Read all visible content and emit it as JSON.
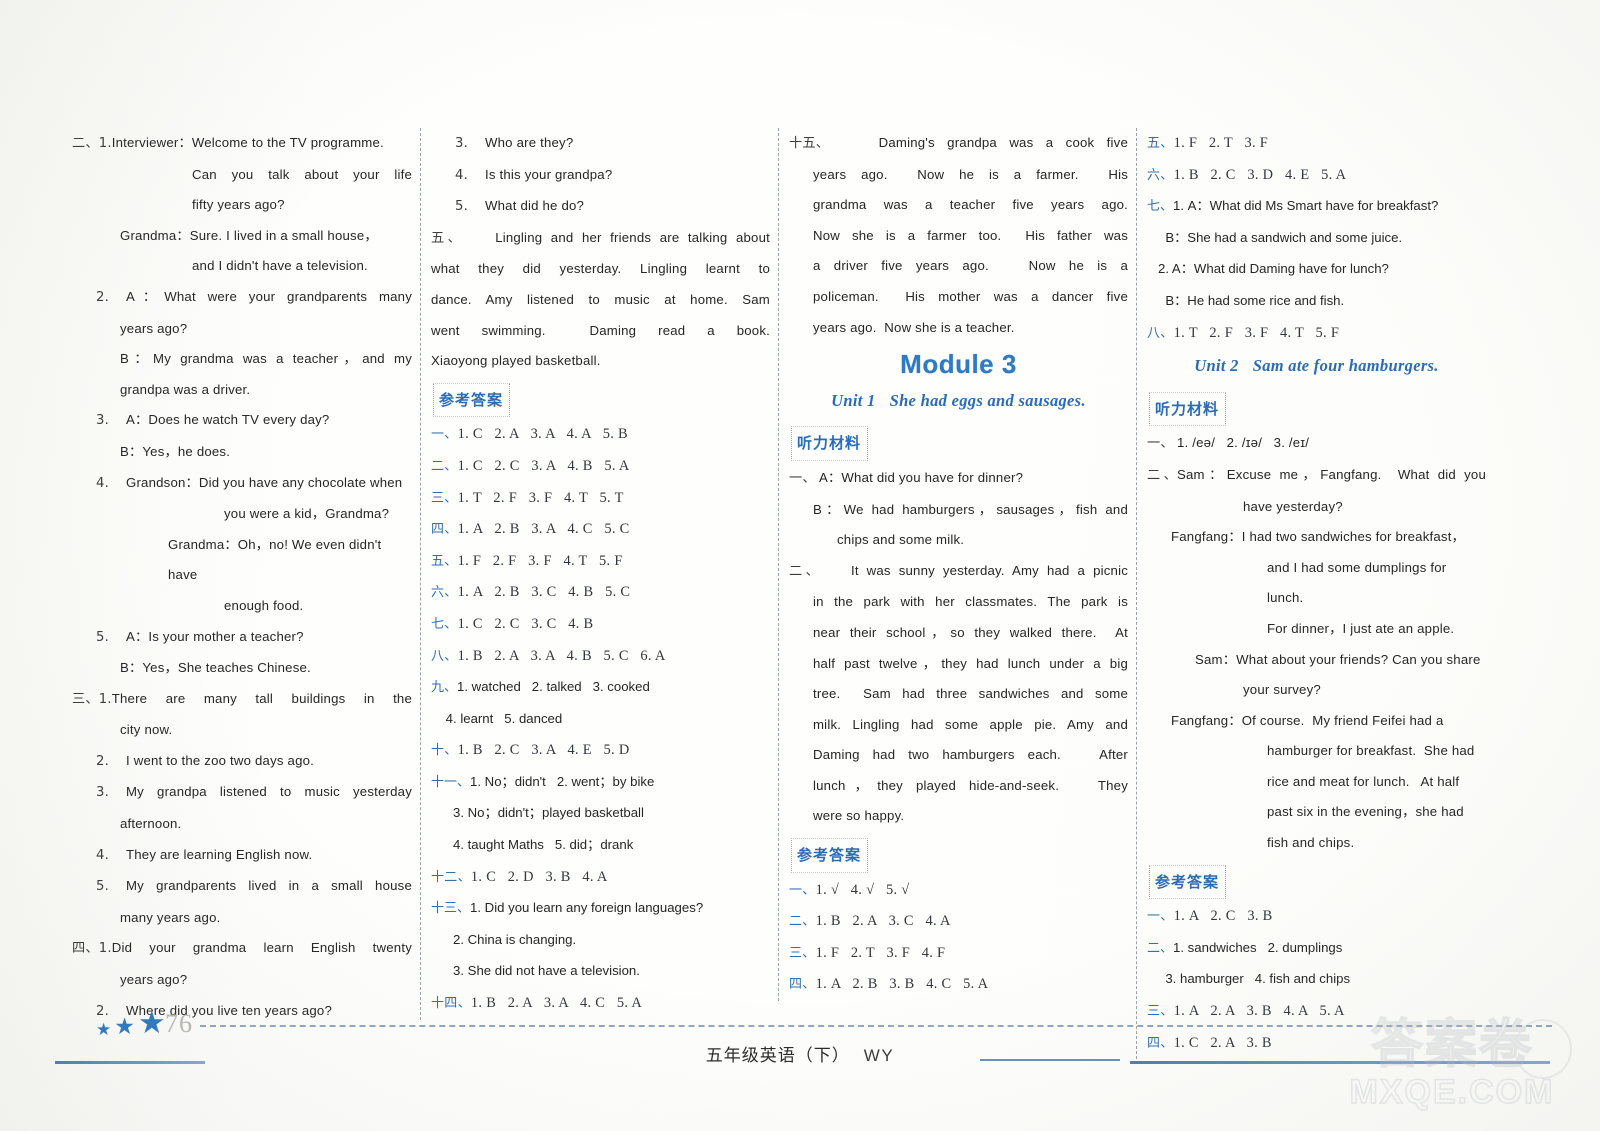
{
  "page": {
    "number": "76",
    "footer_label": "五年级英语（下）",
    "footer_edition": "WY",
    "watermark_cn": "答案卷",
    "watermark_en": "MXQE.COM"
  },
  "labels": {
    "listening_material": "听力材料",
    "reference_answers": "参考答案"
  },
  "column1": {
    "lines": [
      {
        "idx": "二、1.",
        "text": "Interviewer：Welcome to the TV programme.",
        "indent": 0,
        "justify": false
      },
      {
        "idx": "",
        "text": "Can you talk about your life",
        "indent": 4,
        "justify": true
      },
      {
        "idx": "",
        "text": "fifty years ago?",
        "indent": 4,
        "justify": false
      },
      {
        "idx": "",
        "text": "Grandma：Sure. I lived in a small house，",
        "indent": 2,
        "justify": false
      },
      {
        "idx": "",
        "text": "and I didn't have a television.",
        "indent": 4,
        "justify": false
      },
      {
        "idx": "2.",
        "text": "A：What were your grandparents many",
        "indent": 1,
        "justify": true
      },
      {
        "idx": "",
        "text": "years ago?",
        "indent": 2,
        "justify": false
      },
      {
        "idx": "",
        "text": "B：My grandma was a teacher，and my",
        "indent": 2,
        "justify": true
      },
      {
        "idx": "",
        "text": "grandpa was a driver.",
        "indent": 2,
        "justify": false
      },
      {
        "idx": "3.",
        "text": "A：Does he watch TV every day?",
        "indent": 1,
        "justify": false
      },
      {
        "idx": "",
        "text": "B：Yes，he does.",
        "indent": 2,
        "justify": false
      },
      {
        "idx": "4.",
        "text": "Grandson：Did you have any chocolate when",
        "indent": 1,
        "justify": false
      },
      {
        "idx": "",
        "text": "you were a kid，Grandma?",
        "indent": 5,
        "justify": false
      },
      {
        "idx": "",
        "text": "Grandma：Oh，no! We even didn't have",
        "indent": 3,
        "justify": false
      },
      {
        "idx": "",
        "text": "enough food.",
        "indent": 5,
        "justify": false
      },
      {
        "idx": "5.",
        "text": "A：Is your mother a teacher?",
        "indent": 1,
        "justify": false
      },
      {
        "idx": "",
        "text": "B：Yes，She teaches Chinese.",
        "indent": 2,
        "justify": false
      },
      {
        "idx": "三、1.",
        "text": "There are many tall buildings in the",
        "indent": 0,
        "justify": true
      },
      {
        "idx": "",
        "text": "city now.",
        "indent": 2,
        "justify": false
      },
      {
        "idx": "2.",
        "text": "I went to the zoo two days ago.",
        "indent": 1,
        "justify": false
      },
      {
        "idx": "3.",
        "text": "My grandpa listened to music yesterday",
        "indent": 1,
        "justify": true
      },
      {
        "idx": "",
        "text": "afternoon.",
        "indent": 2,
        "justify": false
      },
      {
        "idx": "4.",
        "text": "They are learning English now.",
        "indent": 1,
        "justify": false
      },
      {
        "idx": "5.",
        "text": "My grandparents lived in a small house",
        "indent": 1,
        "justify": true
      },
      {
        "idx": "",
        "text": "many years ago.",
        "indent": 2,
        "justify": false
      },
      {
        "idx": "四、1.",
        "text": "Did your grandma learn English twenty",
        "indent": 0,
        "justify": true
      },
      {
        "idx": "",
        "text": "years ago?",
        "indent": 2,
        "justify": false
      },
      {
        "idx": "2.",
        "text": "Where did you live ten years ago?",
        "indent": 1,
        "justify": false
      }
    ]
  },
  "column2": {
    "lines_top": [
      {
        "idx": "3.",
        "text": "Who are they?",
        "indent": 1,
        "justify": false
      },
      {
        "idx": "4.",
        "text": "Is this your grandpa?",
        "indent": 1,
        "justify": false
      },
      {
        "idx": "5.",
        "text": "What did he do?",
        "indent": 1,
        "justify": false
      },
      {
        "idx": "五、",
        "text": "    Lingling and her friends are talking about",
        "indent": 0,
        "justify": true
      },
      {
        "idx": "",
        "text": "what they did yesterday. Lingling learnt to",
        "indent": 0,
        "justify": true
      },
      {
        "idx": "",
        "text": "dance. Amy listened to music at home. Sam",
        "indent": 0,
        "justify": true
      },
      {
        "idx": "",
        "text": "went swimming.  Daming read a book.",
        "indent": 0,
        "justify": true
      },
      {
        "idx": "",
        "text": "Xiaoyong played basketball.",
        "indent": 0,
        "justify": false
      }
    ],
    "answers": [
      {
        "key": "一、",
        "text": "1. C   2. A   3. A   4. A   5. B",
        "serif": true
      },
      {
        "key": "二、",
        "text": "1. C   2. C   3. A   4. B   5. A",
        "serif": true
      },
      {
        "key": "三、",
        "text": "1. T   2. F   3. F   4. T   5. T",
        "serif": true
      },
      {
        "key": "四、",
        "text": "1. A   2. B   3. A   4. C   5. C",
        "serif": true
      },
      {
        "key": "五、",
        "text": "1. F   2. F   3. F   4. T   5. F",
        "serif": true
      },
      {
        "key": "六、",
        "text": "1. A   2. B   3. C   4. B   5. C",
        "serif": true
      },
      {
        "key": "七、",
        "text": "1. C   2. C   3. C   4. B",
        "serif": true
      },
      {
        "key": "八、",
        "text": "1. B   2. A   3. A   4. B   5. C   6. A",
        "serif": true
      },
      {
        "key": "九、",
        "text": "1. watched   2. talked   3. cooked",
        "serif": false
      },
      {
        "key": "",
        "text": "    4. learnt   5. danced",
        "serif": false
      },
      {
        "key": "十、",
        "text": "1. B   2. C   3. A   4. E   5. D",
        "serif": true
      },
      {
        "key": "十一、",
        "text": "1. No；didn't   2. went；by bike",
        "serif": false
      },
      {
        "key": "",
        "text": "      3. No；didn't；played basketball",
        "serif": false
      },
      {
        "key": "",
        "text": "      4. taught Maths   5. did；drank",
        "serif": false
      },
      {
        "key": "十二、",
        "text": "1. C   2. D   3. B   4. A",
        "serif": true
      },
      {
        "key": "十三、",
        "text": "1. Did you learn any foreign languages?",
        "serif": false
      },
      {
        "key": "",
        "text": "      2. China is changing.",
        "serif": false
      },
      {
        "key": "",
        "text": "      3. She did not have a television.",
        "serif": false
      },
      {
        "key": "十四、",
        "text": "1. B   2. A   3. A   4. C   5. A",
        "serif": true
      }
    ]
  },
  "column3": {
    "lines_top": [
      {
        "idx": "十五、",
        "text": "    Daming's grandpa was a cook five",
        "indent": 0,
        "justify": true
      },
      {
        "idx": "",
        "text": "years ago.  Now he is a farmer.  His",
        "indent": 1,
        "justify": true
      },
      {
        "idx": "",
        "text": "grandma was a teacher five years ago.",
        "indent": 1,
        "justify": true
      },
      {
        "idx": "",
        "text": "Now she is a farmer too.  His father was",
        "indent": 1,
        "justify": true
      },
      {
        "idx": "",
        "text": "a driver five years ago.   Now he is a",
        "indent": 1,
        "justify": true
      },
      {
        "idx": "",
        "text": "policeman.  His mother was a dancer five",
        "indent": 1,
        "justify": true
      },
      {
        "idx": "",
        "text": "years ago.  Now she is a teacher.",
        "indent": 1,
        "justify": false
      }
    ],
    "module_title": "Module 3",
    "unit_number": "Unit 1",
    "unit_name": "She had eggs and sausages.",
    "listening": [
      {
        "idx": "一、",
        "text": "A：What did you have for dinner?",
        "indent": 0,
        "justify": false
      },
      {
        "idx": "",
        "text": "B：We had hamburgers，sausages，fish and",
        "indent": 1,
        "justify": true
      },
      {
        "idx": "",
        "text": "chips and some milk.",
        "indent": 2,
        "justify": false
      },
      {
        "idx": "二、",
        "text": "    It was sunny yesterday. Amy had a picnic",
        "indent": 0,
        "justify": true
      },
      {
        "idx": "",
        "text": "in the park with her classmates. The park is",
        "indent": 1,
        "justify": true
      },
      {
        "idx": "",
        "text": "near their school，so they walked there.  At",
        "indent": 1,
        "justify": true
      },
      {
        "idx": "",
        "text": "half past twelve，they had lunch under a big",
        "indent": 1,
        "justify": true
      },
      {
        "idx": "",
        "text": "tree.  Sam had three sandwiches and some",
        "indent": 1,
        "justify": true
      },
      {
        "idx": "",
        "text": "milk. Lingling had some apple pie. Amy and",
        "indent": 1,
        "justify": true
      },
      {
        "idx": "",
        "text": "Daming had two hamburgers each.   After",
        "indent": 1,
        "justify": true
      },
      {
        "idx": "",
        "text": "lunch，they played hide-and-seek.   They",
        "indent": 1,
        "justify": true
      },
      {
        "idx": "",
        "text": "were so happy.",
        "indent": 1,
        "justify": false
      }
    ],
    "answers": [
      {
        "key": "一、",
        "text": "1. √   4. √   5. √",
        "serif": true
      },
      {
        "key": "二、",
        "text": "1. B   2. A   3. C   4. A",
        "serif": true
      },
      {
        "key": "三、",
        "text": "1. F   2. T   3. F   4. F",
        "serif": true
      },
      {
        "key": "四、",
        "text": "1. A   2. B   3. B   4. C   5. A",
        "serif": true
      }
    ]
  },
  "column4": {
    "answers_top": [
      {
        "key": "五、",
        "text": "1. F   2. T   3. F",
        "serif": true
      },
      {
        "key": "六、",
        "text": "1. B   2. C   3. D   4. E   5. A",
        "serif": true
      },
      {
        "key": "七、",
        "text": "1. A：What did Ms Smart have for breakfast?",
        "serif": false
      },
      {
        "key": "",
        "text": "     B：She had a sandwich and some juice.",
        "serif": false
      },
      {
        "key": "",
        "text": "   2. A：What did Daming have for lunch?",
        "serif": false
      },
      {
        "key": "",
        "text": "     B：He had some rice and fish.",
        "serif": false
      },
      {
        "key": "八、",
        "text": "1. T   2. F   3. F   4. T   5. F",
        "serif": true
      }
    ],
    "unit_number": "Unit 2",
    "unit_name": "Sam ate four hamburgers.",
    "listening": [
      {
        "idx": "一、",
        "text": "1. /eə/   2. /ɪə/   3. /eɪ/",
        "indent": 0,
        "justify": false
      },
      {
        "idx": "二、",
        "text": "Sam：Excuse me，Fangfang.  What did you",
        "indent": 0,
        "justify": true
      },
      {
        "idx": "",
        "text": "have yesterday?",
        "indent": 3,
        "justify": false
      },
      {
        "idx": "",
        "text": "Fangfang：I had two sandwiches for breakfast，",
        "indent": 1,
        "justify": false
      },
      {
        "idx": "",
        "text": "and I had some dumplings for lunch.",
        "indent": 4,
        "justify": false
      },
      {
        "idx": "",
        "text": "For dinner，I just ate an apple.",
        "indent": 4,
        "justify": false
      },
      {
        "idx": "",
        "text": "Sam：What about your friends? Can you share",
        "indent": 2,
        "justify": false
      },
      {
        "idx": "",
        "text": "your survey?",
        "indent": 3,
        "justify": false
      },
      {
        "idx": "",
        "text": "Fangfang：Of course.  My friend Feifei had a",
        "indent": 1,
        "justify": false
      },
      {
        "idx": "",
        "text": "hamburger for breakfast.  She had",
        "indent": 4,
        "justify": false
      },
      {
        "idx": "",
        "text": "rice and meat for lunch.   At half",
        "indent": 4,
        "justify": false
      },
      {
        "idx": "",
        "text": "past six in the evening，she had",
        "indent": 4,
        "justify": false
      },
      {
        "idx": "",
        "text": "fish and chips.",
        "indent": 4,
        "justify": false
      }
    ],
    "answers": [
      {
        "key": "一、",
        "text": "1. A   2. C   3. B",
        "serif": true
      },
      {
        "key": "二、",
        "text": "1. sandwiches   2. dumplings",
        "serif": false
      },
      {
        "key": "",
        "text": "     3. hamburger   4. fish and chips",
        "serif": false
      },
      {
        "key": "三、",
        "text": "1. A   2. A   3. B   4. A   5. A",
        "serif": true
      },
      {
        "key": "四、",
        "text": "1. C   2. A   3. B",
        "serif": true
      }
    ]
  }
}
